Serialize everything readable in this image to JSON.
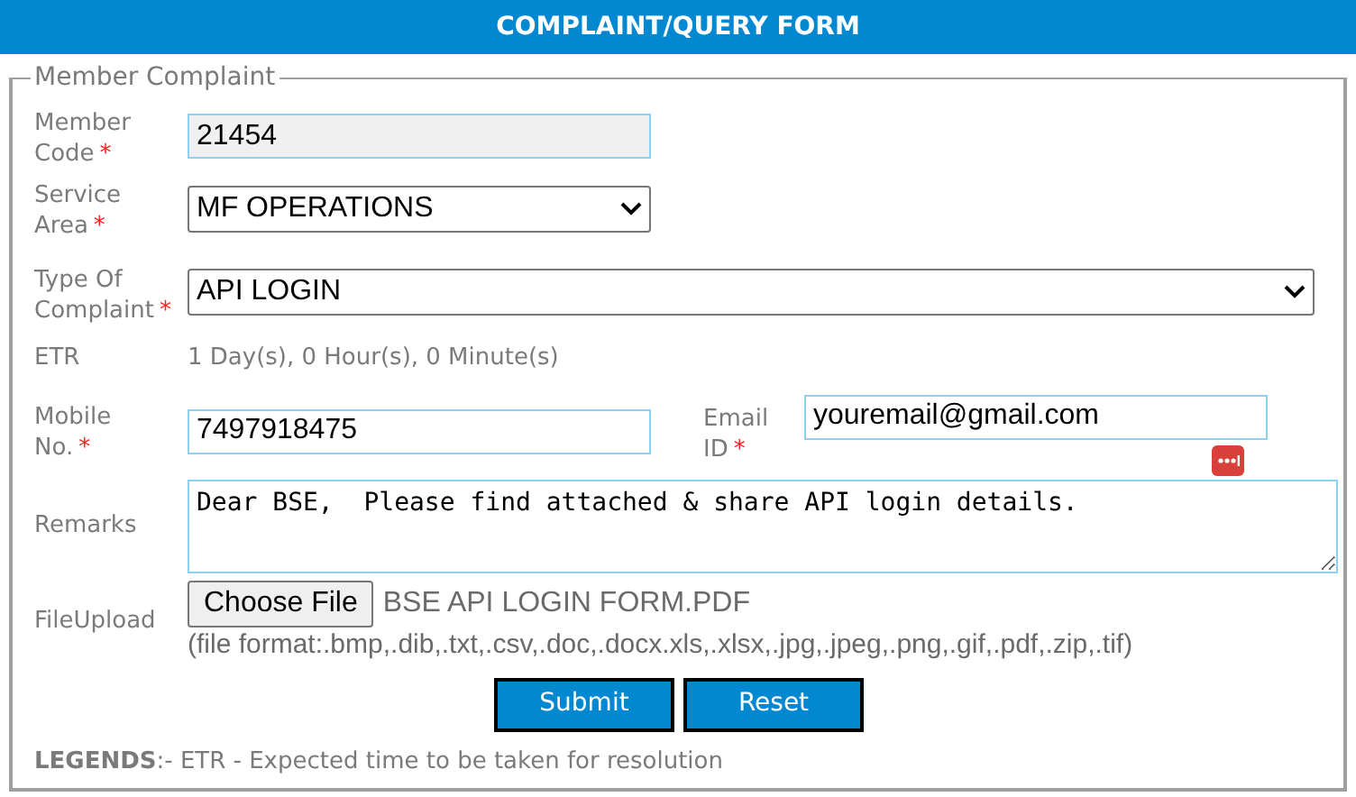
{
  "header": {
    "title": "COMPLAINT/QUERY FORM"
  },
  "section": {
    "legend": "Member Complaint"
  },
  "member_code": {
    "label": "Member Code",
    "marker": "*",
    "value": "21454",
    "disabled": true
  },
  "service_area": {
    "label": "Service Area",
    "marker": "*",
    "value": "MF OPERATIONS"
  },
  "complaint_type": {
    "label": "Type Of Complaint",
    "marker": "*",
    "value": "API LOGIN"
  },
  "etr": {
    "label": "ETR",
    "value": "1 Day(s), 0 Hour(s), 0 Minute(s)"
  },
  "mobile": {
    "label": "Mobile No.",
    "marker": "*",
    "value": "7497918475"
  },
  "email": {
    "label": "Email ID",
    "marker": "*",
    "value": "youremail@gmail.com"
  },
  "remarks": {
    "label": "Remarks",
    "value": "Dear BSE,  Please find attached & share API login details."
  },
  "file_upload": {
    "label": "FileUpload",
    "button": "Choose File",
    "file_name": "BSE API LOGIN FORM.PDF",
    "hint": "(file format:.bmp,.dib,.txt,.csv,.doc,.docx.xls,.xlsx,.jpg,.jpeg,.png,.gif,.pdf,.zip,.tif)"
  },
  "buttons": [
    {
      "label": "Submit"
    },
    {
      "label": "Reset"
    }
  ],
  "legend_note": {
    "term": "LEGENDS",
    "text": ":- ETR - Expected time to be taken for resolution"
  }
}
